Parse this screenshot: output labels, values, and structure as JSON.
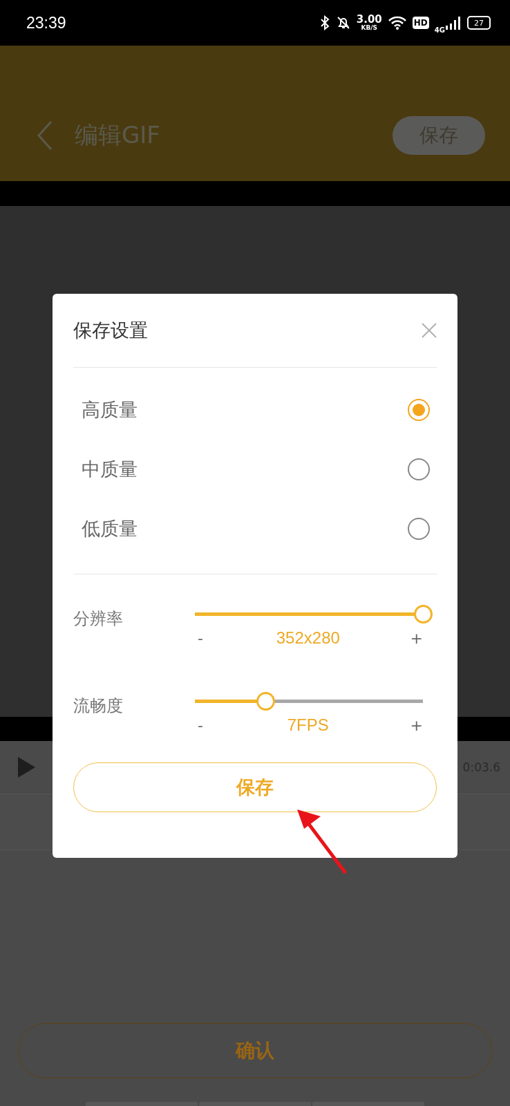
{
  "status_bar": {
    "time": "23:39",
    "net_speed": "3.00",
    "net_unit": "KB/S",
    "hd": "HD",
    "network_type": "4G",
    "battery": "27"
  },
  "header": {
    "title": "编辑GIF",
    "save_button": "保存"
  },
  "player": {
    "time": "0:03.6"
  },
  "dialog": {
    "title": "保存设置",
    "options": [
      {
        "label": "高质量",
        "selected": true
      },
      {
        "label": "中质量",
        "selected": false
      },
      {
        "label": "低质量",
        "selected": false
      }
    ],
    "sliders": [
      {
        "label": "分辨率",
        "level": 1.0,
        "minus": "-",
        "value": "352x280",
        "plus": "+"
      },
      {
        "label": "流畅度",
        "level": 0.31,
        "minus": "-",
        "value": "7FPS",
        "plus": "+"
      }
    ],
    "save_button": "保存"
  },
  "confirm_button": "确认"
}
